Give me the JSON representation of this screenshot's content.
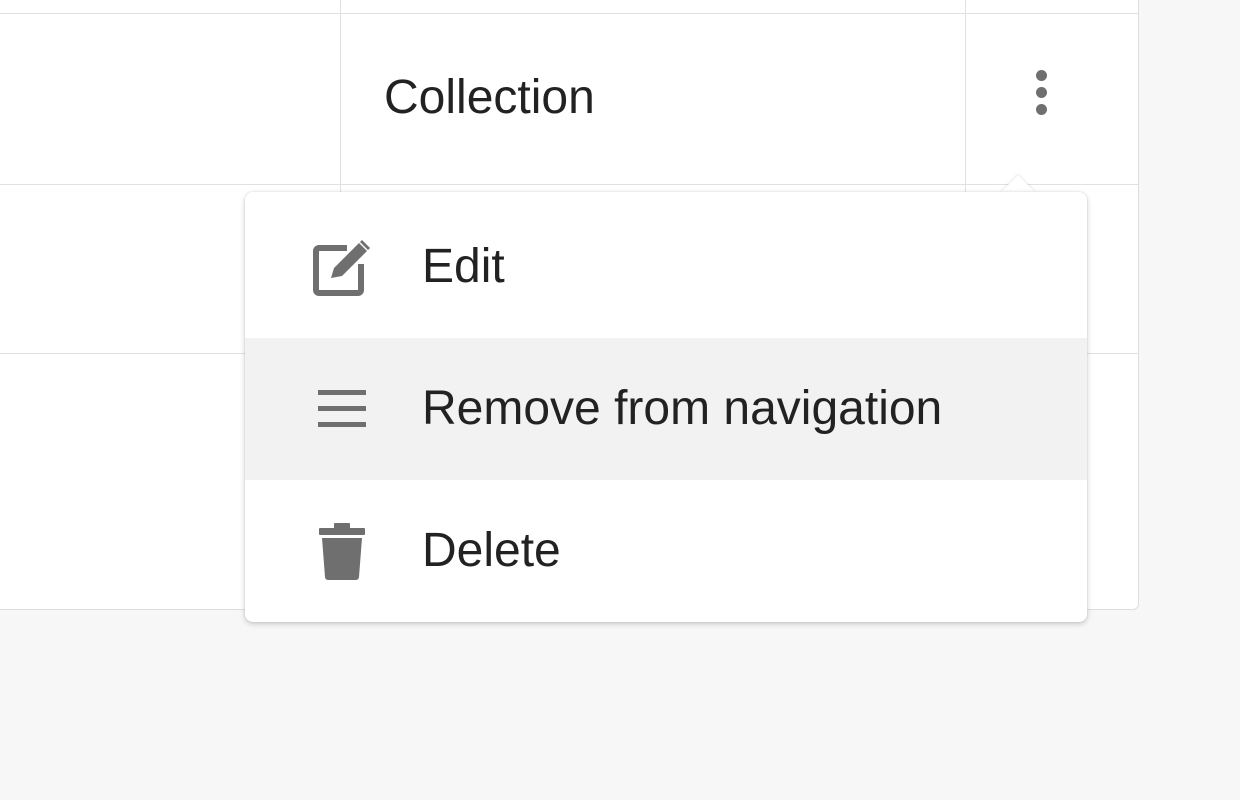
{
  "table": {
    "row_type_value": "Collection",
    "actions_icon": "more-vertical-icon"
  },
  "menu": {
    "items": [
      {
        "label": "Edit",
        "icon": "edit-icon",
        "highlighted": false
      },
      {
        "label": "Remove from navigation",
        "icon": "menu-lines-icon",
        "highlighted": true
      },
      {
        "label": "Delete",
        "icon": "trash-icon",
        "highlighted": false
      }
    ]
  },
  "colors": {
    "icon_gray": "#6f6f6f",
    "text": "#222222",
    "highlight_row": "#f2f2f2",
    "grid_line": "#e1e1e1",
    "page_background": "#f7f7f7"
  }
}
